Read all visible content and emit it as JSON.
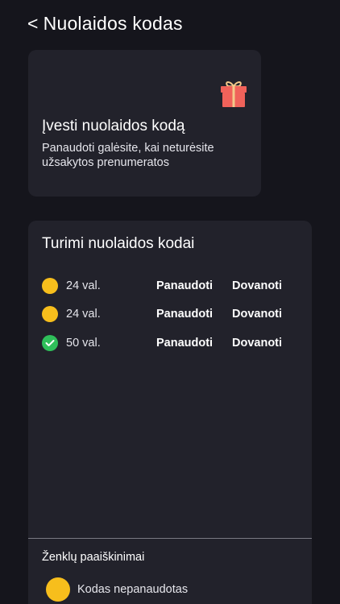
{
  "header": {
    "back_symbol": "<",
    "title": "Nuolaidos kodas"
  },
  "promo": {
    "title": "Įvesti nuolaidos kodą",
    "subtitle": "Panaudoti galėsite, kai neturėsite užsakytos prenumeratos",
    "icon": "gift-icon"
  },
  "codes": {
    "title": "Turimi nuolaidos kodai",
    "items": [
      {
        "amount": "24 val.",
        "status": "unused",
        "use_label": "Panaudoti",
        "gift_label": "Dovanoti"
      },
      {
        "amount": "24 val.",
        "status": "unused",
        "use_label": "Panaudoti",
        "gift_label": "Dovanoti"
      },
      {
        "amount": "50 val.",
        "status": "used",
        "use_label": "Panaudoti",
        "gift_label": "Dovanoti"
      }
    ]
  },
  "legend": {
    "title": "Ženklų paaiškinimai",
    "items": [
      {
        "label": "Kodas nepanaudotas",
        "color": "#f7be1c"
      }
    ]
  },
  "colors": {
    "background": "#15151c",
    "card": "#22222b",
    "unused": "#f7be1c",
    "used": "#2fbf5a",
    "gift_box": "#f0625a"
  }
}
